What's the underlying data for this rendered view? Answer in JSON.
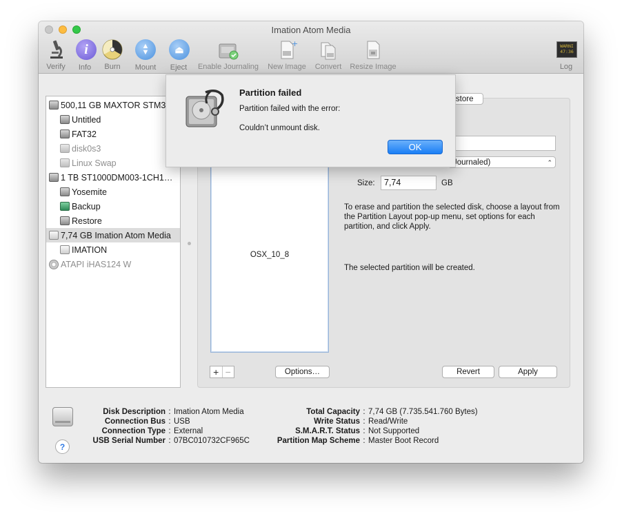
{
  "window": {
    "title": "Imation Atom Media"
  },
  "toolbar": [
    {
      "label": "Verify",
      "icon": "microscope-icon"
    },
    {
      "label": "Info",
      "icon": "info-icon"
    },
    {
      "label": "Burn",
      "icon": "burn-icon"
    },
    {
      "label": "Mount",
      "icon": "mount-icon"
    },
    {
      "label": "Eject",
      "icon": "eject-icon"
    },
    {
      "label": "Enable Journaling",
      "icon": "journal-disk-icon"
    },
    {
      "label": "New Image",
      "icon": "new-image-icon"
    },
    {
      "label": "Convert",
      "icon": "convert-icon"
    },
    {
      "label": "Resize Image",
      "icon": "resize-image-icon"
    },
    {
      "label": "Log",
      "icon": "log-icon",
      "badge": "WARNI\n47:36"
    }
  ],
  "sidebar": {
    "items": [
      {
        "label": "500,11 GB MAXTOR STM3",
        "indent": 0,
        "icon": "hdd",
        "dim": false
      },
      {
        "label": "Untitled",
        "indent": 1,
        "icon": "hdd",
        "dim": false
      },
      {
        "label": "FAT32",
        "indent": 1,
        "icon": "hdd",
        "dim": false
      },
      {
        "label": "disk0s3",
        "indent": 1,
        "icon": "hdd",
        "dim": true
      },
      {
        "label": "Linux Swap",
        "indent": 1,
        "icon": "hdd",
        "dim": true
      },
      {
        "label": "1 TB ST1000DM003-1CH1…",
        "indent": 0,
        "icon": "hdd",
        "dim": false
      },
      {
        "label": "Yosemite",
        "indent": 1,
        "icon": "hdd",
        "dim": false
      },
      {
        "label": "Backup",
        "indent": 1,
        "icon": "green",
        "dim": false
      },
      {
        "label": "Restore",
        "indent": 1,
        "icon": "hdd",
        "dim": false
      },
      {
        "label": "7,74 GB Imation Atom Media",
        "indent": 0,
        "icon": "white",
        "dim": false,
        "selected": true
      },
      {
        "label": "IMATION",
        "indent": 1,
        "icon": "white",
        "dim": false
      },
      {
        "label": "ATAPI iHAS124 W",
        "indent": 0,
        "icon": "optical",
        "dim": true
      }
    ]
  },
  "partition": {
    "restore_tab": "estore",
    "format_partial": "Journaled)",
    "size_label": "Size:",
    "size_value": "7,74",
    "size_unit": "GB",
    "layout_partition_name": "OSX_10_8",
    "instructions": "To erase and partition the selected disk, choose a layout from the Partition Layout pop-up menu, set options for each partition, and click Apply.",
    "status": "The selected partition will be created.",
    "plus": "+",
    "minus": "−",
    "options_label": "Options…",
    "revert_label": "Revert",
    "apply_label": "Apply"
  },
  "footer": {
    "left": [
      {
        "key": "Disk Description",
        "value": "Imation Atom Media"
      },
      {
        "key": "Connection Bus",
        "value": "USB"
      },
      {
        "key": "Connection Type",
        "value": "External"
      },
      {
        "key": "USB Serial Number",
        "value": "07BC010732CF965C"
      }
    ],
    "right": [
      {
        "key": "Total Capacity",
        "value": "7,74 GB (7.735.541.760 Bytes)"
      },
      {
        "key": "Write Status",
        "value": "Read/Write"
      },
      {
        "key": "S.M.A.R.T. Status",
        "value": "Not Supported"
      },
      {
        "key": "Partition Map Scheme",
        "value": "Master Boot Record"
      }
    ],
    "help": "?"
  },
  "alert": {
    "title": "Partition failed",
    "message": "Partition failed with the error:",
    "detail": "Couldn’t unmount disk.",
    "ok_label": "OK"
  },
  "colors": {
    "accent": "#1a7ef5",
    "minimize": "#fdbc40",
    "zoom": "#34c84a"
  }
}
